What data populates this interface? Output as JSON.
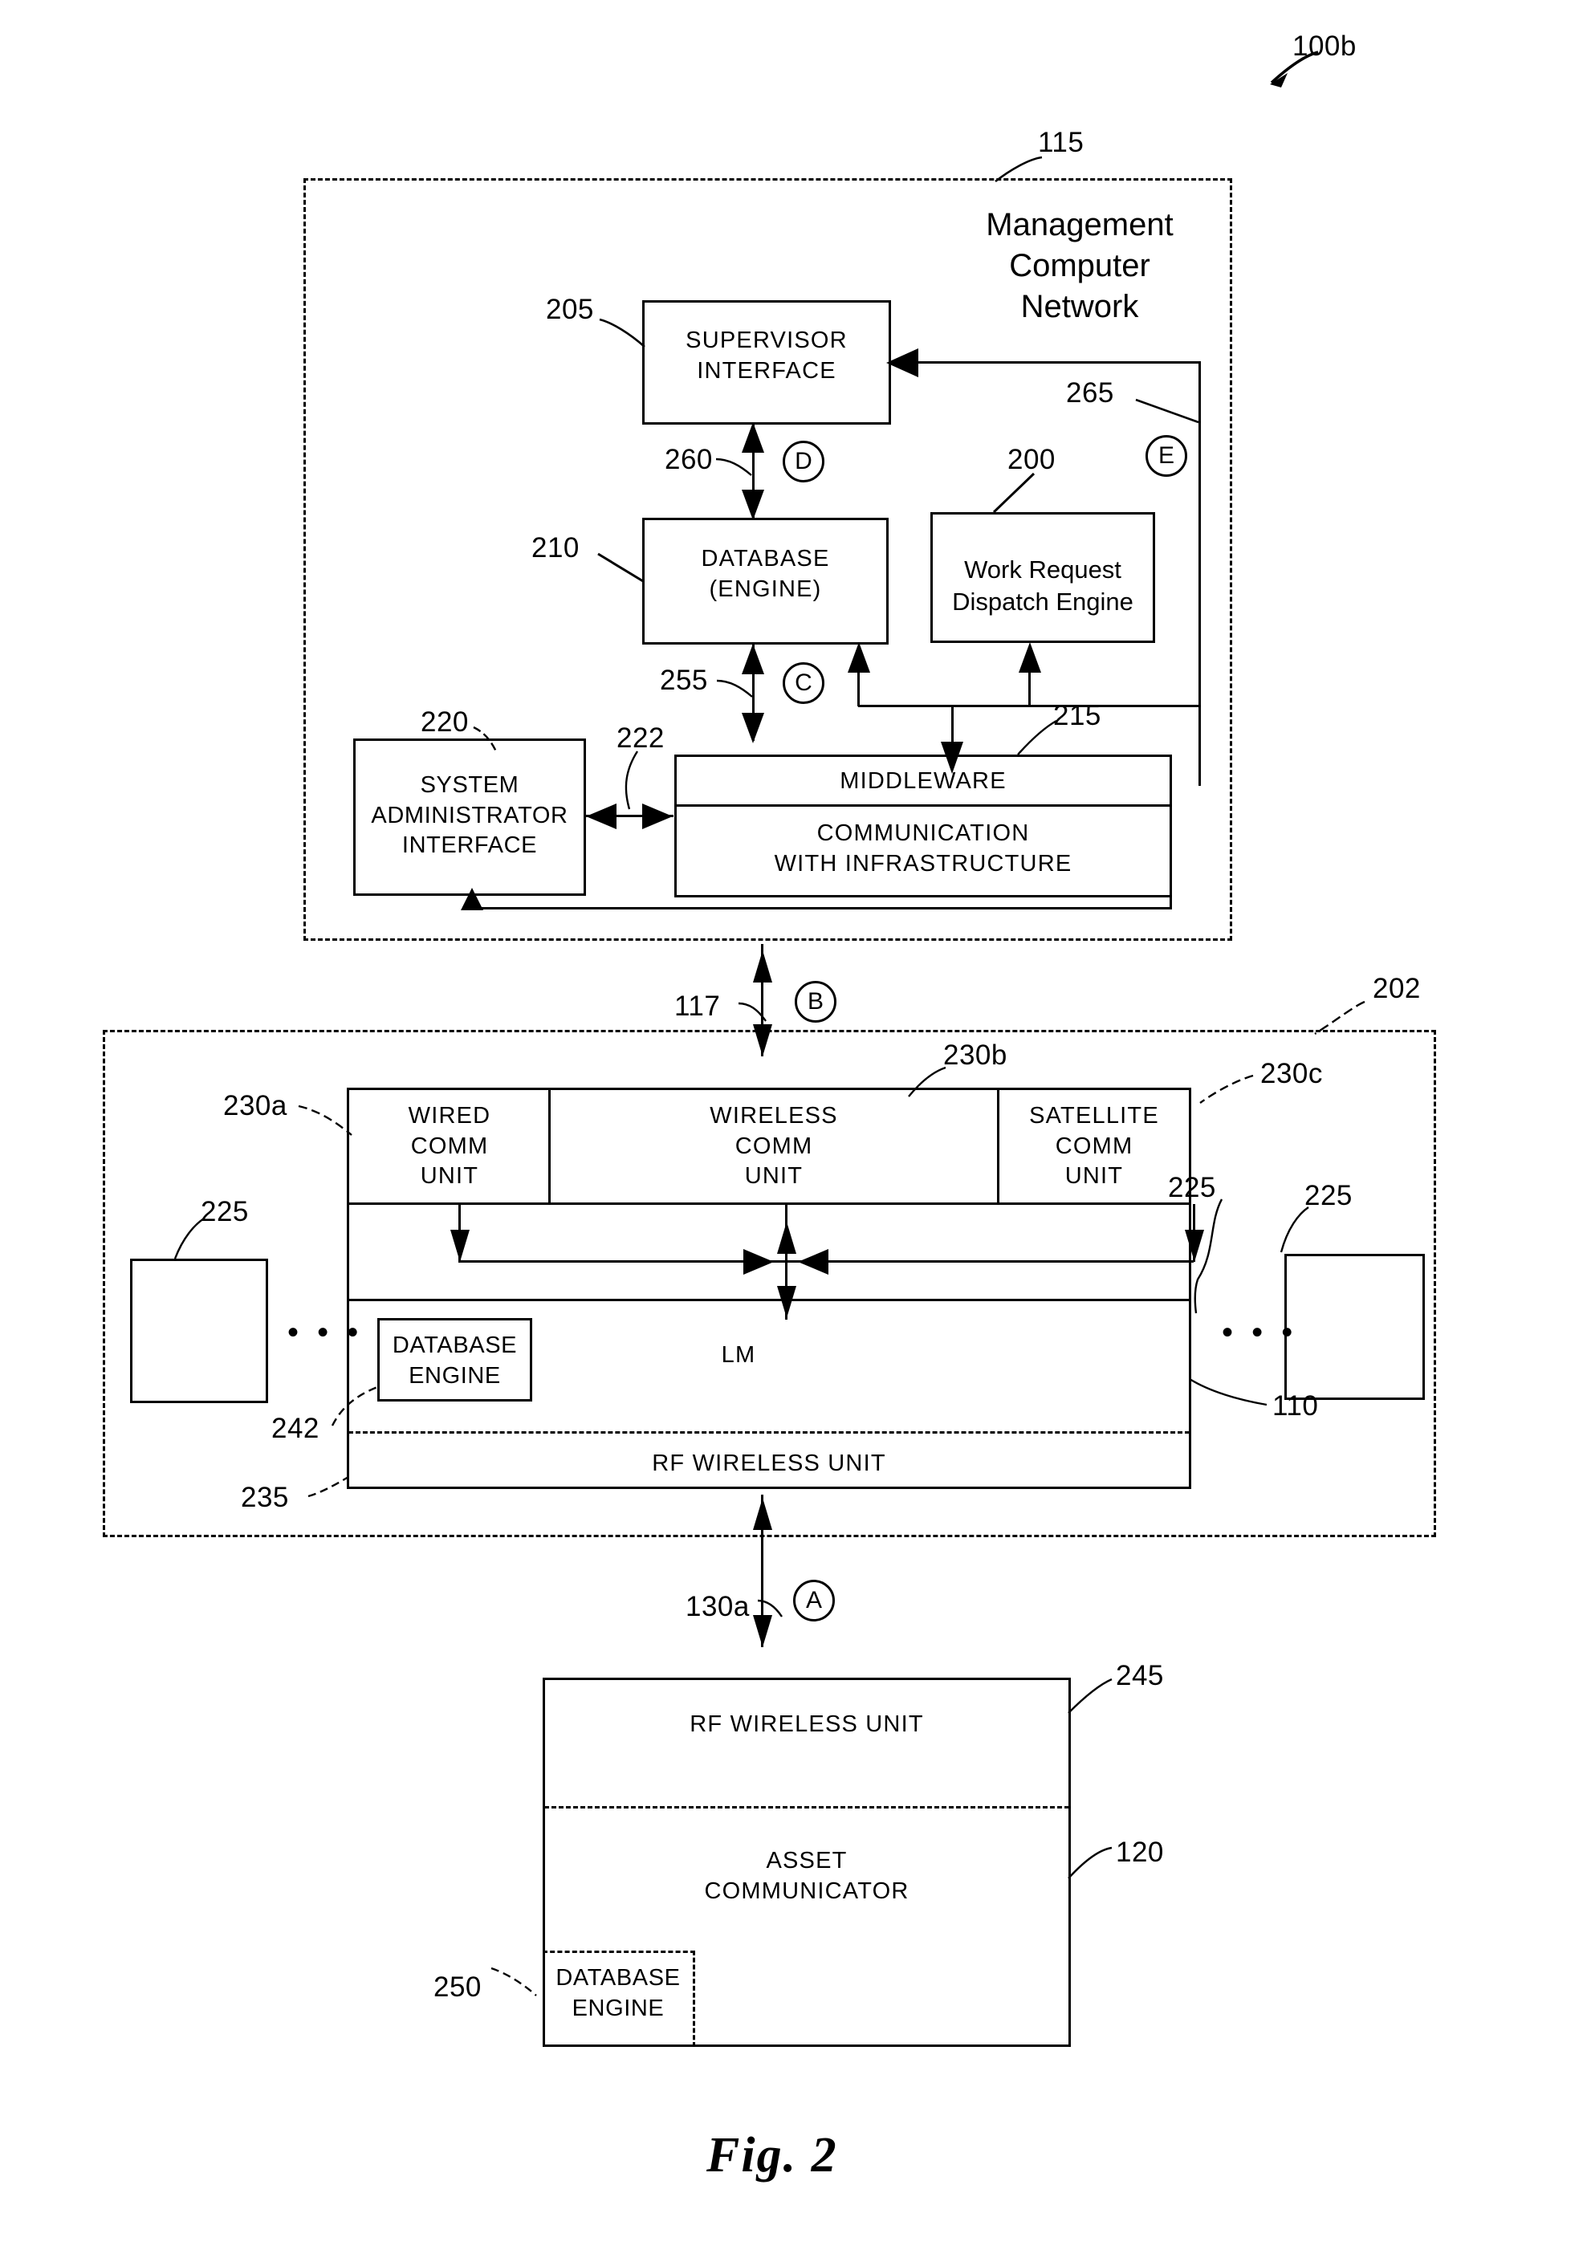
{
  "figure": {
    "caption": "Fig. 2",
    "system_ref": "100b"
  },
  "management_network": {
    "ref": "115",
    "title": "Management\nComputer\nNetwork",
    "supervisor_interface": {
      "ref": "205",
      "label": "SUPERVISOR\nINTERFACE"
    },
    "database_engine": {
      "ref": "210",
      "label": "DATABASE\n(ENGINE)"
    },
    "work_request_dispatch_engine": {
      "ref": "200",
      "label": "Work Request\nDispatch Engine"
    },
    "system_administrator_interface": {
      "ref": "220",
      "label": "SYSTEM\nADMINISTRATOR\nINTERFACE"
    },
    "middleware": {
      "ref": "215",
      "label": "MIDDLEWARE",
      "sublabel": "COMMUNICATION\nWITH INFRASTRUCTURE"
    },
    "links": {
      "supervisor_to_database": {
        "ref": "260",
        "marker": "D"
      },
      "database_to_middleware": {
        "ref": "255",
        "marker": "C"
      },
      "admin_to_middleware": {
        "ref": "222"
      },
      "dispatch_return": {
        "ref": "265",
        "marker": "E"
      }
    }
  },
  "infrastructure": {
    "ref": "202",
    "lm_unit_ref": "110",
    "comm_units": [
      {
        "ref": "230a",
        "label": "WIRED\nCOMM\nUNIT"
      },
      {
        "ref": "230b",
        "label": "WIRELESS\nCOMM\nUNIT"
      },
      {
        "ref": "230c",
        "label": "SATELLITE\nCOMM\nUNIT"
      }
    ],
    "lm": {
      "label": "LM"
    },
    "database_engine": {
      "ref": "242",
      "label": "DATABASE\nENGINE"
    },
    "rf_wireless_unit": {
      "ref": "235",
      "label": "RF WIRELESS UNIT"
    },
    "peripheral_units": [
      {
        "ref": "225"
      },
      {
        "ref": "225"
      },
      {
        "ref": "225"
      }
    ],
    "ellipsis": "• • •"
  },
  "asset": {
    "ref": "120",
    "rf_wireless_unit": {
      "ref": "245",
      "label": "RF WIRELESS UNIT"
    },
    "asset_communicator": {
      "label": "ASSET\nCOMMUNICATOR"
    },
    "database_engine": {
      "ref": "250",
      "label": "DATABASE\nENGINE"
    }
  },
  "interconnects": {
    "network_to_infrastructure": {
      "ref": "117",
      "marker": "B"
    },
    "infrastructure_to_asset": {
      "ref": "130a",
      "marker": "A"
    }
  }
}
